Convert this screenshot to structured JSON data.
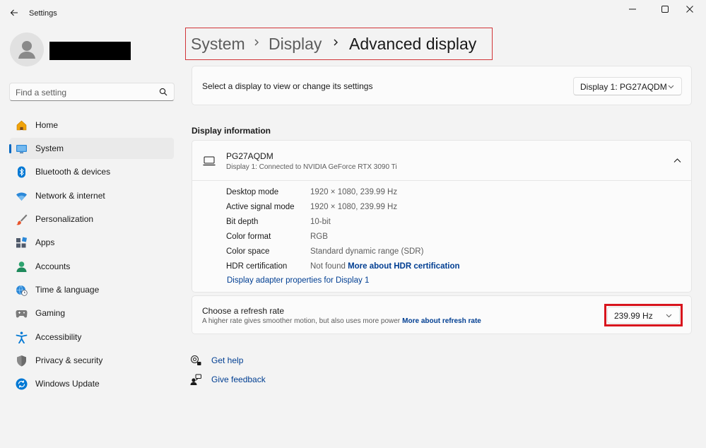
{
  "window": {
    "title": "Settings"
  },
  "sidebar": {
    "search_placeholder": "Find a setting",
    "items": [
      {
        "label": "Home",
        "icon": "home-icon",
        "active": false
      },
      {
        "label": "System",
        "icon": "system-icon",
        "active": true
      },
      {
        "label": "Bluetooth & devices",
        "icon": "bluetooth-icon",
        "active": false
      },
      {
        "label": "Network & internet",
        "icon": "wifi-icon",
        "active": false
      },
      {
        "label": "Personalization",
        "icon": "brush-icon",
        "active": false
      },
      {
        "label": "Apps",
        "icon": "apps-icon",
        "active": false
      },
      {
        "label": "Accounts",
        "icon": "accounts-icon",
        "active": false
      },
      {
        "label": "Time & language",
        "icon": "globe-clock-icon",
        "active": false
      },
      {
        "label": "Gaming",
        "icon": "gamepad-icon",
        "active": false
      },
      {
        "label": "Accessibility",
        "icon": "accessibility-icon",
        "active": false
      },
      {
        "label": "Privacy & security",
        "icon": "shield-icon",
        "active": false
      },
      {
        "label": "Windows Update",
        "icon": "update-icon",
        "active": false
      }
    ]
  },
  "breadcrumb": [
    "System",
    "Display",
    "Advanced display"
  ],
  "display_select": {
    "label": "Select a display to view or change its settings",
    "value": "Display 1: PG27AQDM"
  },
  "display_info": {
    "section_title": "Display information",
    "monitor_name": "PG27AQDM",
    "monitor_sub": "Display 1: Connected to NVIDIA GeForce RTX 3090 Ti",
    "properties": [
      {
        "label": "Desktop mode",
        "value": "1920 × 1080, 239.99 Hz"
      },
      {
        "label": "Active signal mode",
        "value": "1920 × 1080, 239.99 Hz"
      },
      {
        "label": "Bit depth",
        "value": "10-bit"
      },
      {
        "label": "Color format",
        "value": "RGB"
      },
      {
        "label": "Color space",
        "value": "Standard dynamic range (SDR)"
      },
      {
        "label": "HDR certification",
        "value": "Not found",
        "link": "More about HDR certification"
      }
    ],
    "adapter_link": "Display adapter properties for Display 1"
  },
  "refresh_rate": {
    "title": "Choose a refresh rate",
    "description": "A higher rate gives smoother motion, but also uses more power",
    "more_link": "More about refresh rate",
    "value": "239.99 Hz"
  },
  "help": {
    "get_help": "Get help",
    "give_feedback": "Give feedback"
  },
  "colors": {
    "accent": "#0067c0",
    "link": "#003e92",
    "highlight_red": "#d8141d"
  }
}
